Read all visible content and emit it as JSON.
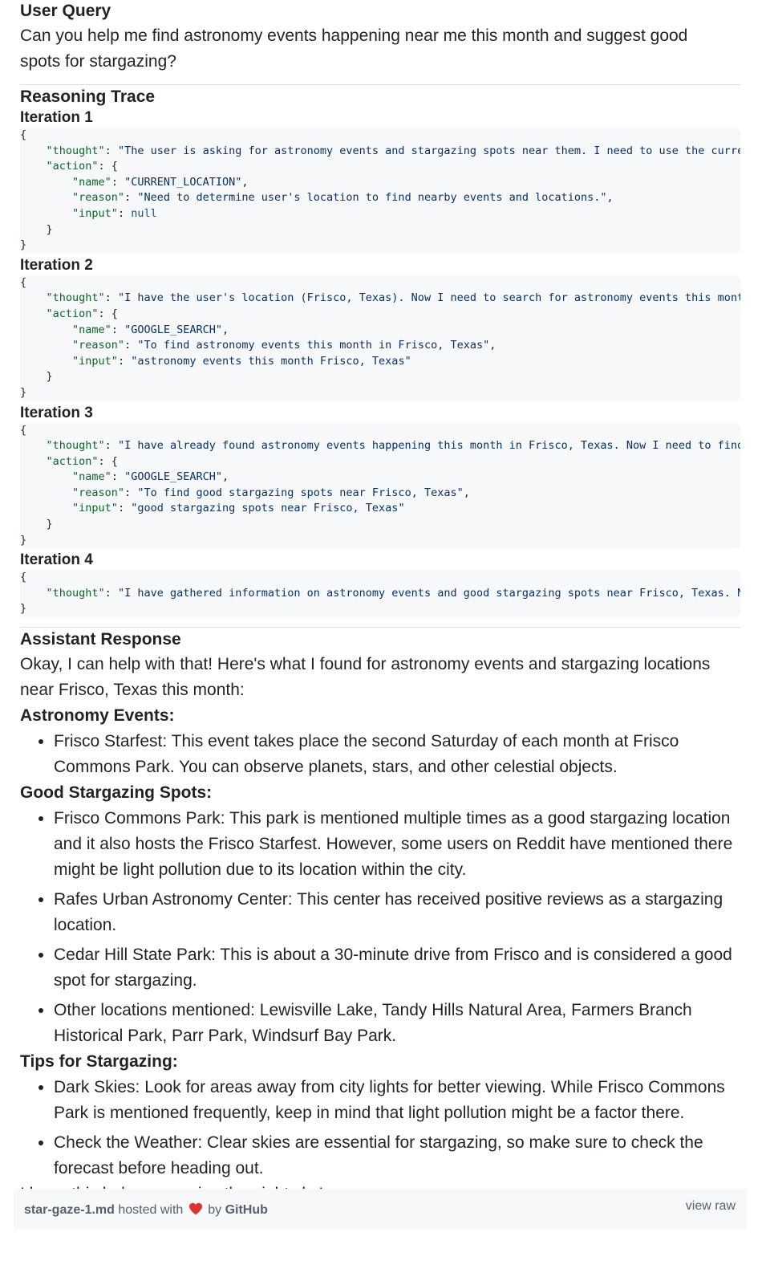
{
  "user_query": {
    "title": "User Query",
    "text": "Can you help me find astronomy events happening near me this month and suggest good spots for stargazing?"
  },
  "reasoning": {
    "title": "Reasoning Trace",
    "iterations": [
      {
        "title": "Iteration 1",
        "open": "{",
        "thought_key": "\"thought\"",
        "thought_value": "\"The user is asking for astronomy events and stargazing spots near them. I need to use the curre",
        "action_key": "\"action\"",
        "name_key": "\"name\"",
        "name_value": "\"CURRENT_LOCATION\"",
        "reason_key": "\"reason\"",
        "reason_value": "\"Need to determine user's location to find nearby events and locations.\"",
        "input_key": "\"input\"",
        "input_value": "null",
        "close_inner": "}",
        "close": "}"
      },
      {
        "title": "Iteration 2",
        "open": "{",
        "thought_key": "\"thought\"",
        "thought_value": "\"I have the user's location (Frisco, Texas). Now I need to search for astronomy events this mont",
        "action_key": "\"action\"",
        "name_key": "\"name\"",
        "name_value": "\"GOOGLE_SEARCH\"",
        "reason_key": "\"reason\"",
        "reason_value": "\"To find astronomy events this month in Frisco, Texas\"",
        "input_key": "\"input\"",
        "input_value": "\"astronomy events this month Frisco, Texas\"",
        "close_inner": "}",
        "close": "}"
      },
      {
        "title": "Iteration 3",
        "open": "{",
        "thought_key": "\"thought\"",
        "thought_value": "\"I have already found astronomy events happening this month in Frisco, Texas. Now I need to find",
        "action_key": "\"action\"",
        "name_key": "\"name\"",
        "name_value": "\"GOOGLE_SEARCH\"",
        "reason_key": "\"reason\"",
        "reason_value": "\"To find good stargazing spots near Frisco, Texas\"",
        "input_key": "\"input\"",
        "input_value": "\"good stargazing spots near Frisco, Texas\"",
        "close_inner": "}",
        "close": "}"
      },
      {
        "title": "Iteration 4",
        "open": "{",
        "thought_key": "\"thought\"",
        "thought_value": "\"I have gathered information on astronomy events and good stargazing spots near Frisco, Texas. N",
        "close": "}"
      }
    ]
  },
  "response": {
    "title": "Assistant Response",
    "intro": "Okay, I can help with that! Here's what I found for astronomy events and stargazing locations near Frisco, Texas this month:",
    "events_title": "Astronomy Events:",
    "events": [
      "Frisco Starfest: This event takes place the second Saturday of each month at Frisco Commons Park. You can observe planets, stars, and other celestial objects."
    ],
    "spots_title": "Good Stargazing Spots:",
    "spots": [
      "Frisco Commons Park: This park is mentioned multiple times as a good stargazing location and it also hosts the Frisco Starfest. However, some users on Reddit have mentioned there might be light pollution due to its location within the city.",
      "Rafes Urban Astronomy Center: This center has received positive reviews as a stargazing location.",
      "Cedar Hill State Park: This is about a 30-minute drive from Frisco and is considered a good spot for stargazing.",
      "Other locations mentioned: Lewisville Lake, Tandy Hills Natural Area, Farmers Branch Historical Park, Parr Park, Windsurf Bay Park."
    ],
    "tips_title": "Tips for Stargazing:",
    "tips": [
      "Dark Skies: Look for areas away from city lights for better viewing. While Frisco Commons Park is mentioned frequently, keep in mind that light pollution might be a factor there.",
      "Check the Weather: Clear skies are essential for stargazing, so make sure to check the forecast before heading out."
    ],
    "closing": "I hope this helps you enjoy the night sky!"
  },
  "footer": {
    "filename": "star-gaze-1.md",
    "hosted_with": "hosted with",
    "by": "by",
    "github": "GitHub",
    "view_raw": "view raw",
    "heart_icon": "heart-icon",
    "heart_color": "#e0332e"
  }
}
